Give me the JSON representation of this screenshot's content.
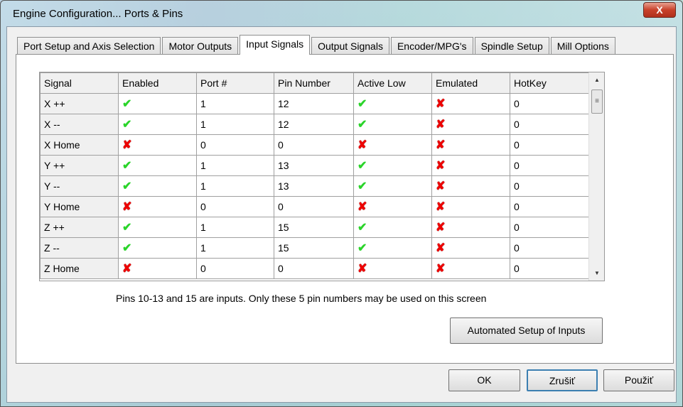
{
  "window": {
    "title": "Engine Configuration... Ports & Pins",
    "close_label": "X"
  },
  "tabs": [
    {
      "label": "Port Setup and Axis Selection"
    },
    {
      "label": "Motor Outputs"
    },
    {
      "label": "Input Signals",
      "active": true
    },
    {
      "label": "Output Signals"
    },
    {
      "label": "Encoder/MPG's"
    },
    {
      "label": "Spindle Setup"
    },
    {
      "label": "Mill Options"
    }
  ],
  "grid": {
    "columns": [
      "Signal",
      "Enabled",
      "Port #",
      "Pin Number",
      "Active Low",
      "Emulated",
      "HotKey"
    ],
    "rows": [
      {
        "signal": "X ++",
        "enabled": true,
        "port": "1",
        "pin": "12",
        "active_low": true,
        "emulated": false,
        "hotkey": "0"
      },
      {
        "signal": "X --",
        "enabled": true,
        "port": "1",
        "pin": "12",
        "active_low": true,
        "emulated": false,
        "hotkey": "0"
      },
      {
        "signal": "X Home",
        "enabled": false,
        "port": "0",
        "pin": "0",
        "active_low": false,
        "emulated": false,
        "hotkey": "0"
      },
      {
        "signal": "Y ++",
        "enabled": true,
        "port": "1",
        "pin": "13",
        "active_low": true,
        "emulated": false,
        "hotkey": "0"
      },
      {
        "signal": "Y --",
        "enabled": true,
        "port": "1",
        "pin": "13",
        "active_low": true,
        "emulated": false,
        "hotkey": "0"
      },
      {
        "signal": "Y Home",
        "enabled": false,
        "port": "0",
        "pin": "0",
        "active_low": false,
        "emulated": false,
        "hotkey": "0"
      },
      {
        "signal": "Z ++",
        "enabled": true,
        "port": "1",
        "pin": "15",
        "active_low": true,
        "emulated": false,
        "hotkey": "0"
      },
      {
        "signal": "Z --",
        "enabled": true,
        "port": "1",
        "pin": "15",
        "active_low": true,
        "emulated": false,
        "hotkey": "0"
      },
      {
        "signal": "Z Home",
        "enabled": false,
        "port": "0",
        "pin": "0",
        "active_low": false,
        "emulated": false,
        "hotkey": "0"
      }
    ],
    "check_icon": "green-check-icon",
    "cross_icon": "red-x-icon"
  },
  "note": "Pins 10-13 and 15 are inputs. Only these 5 pin numbers may be used on this screen",
  "buttons": {
    "automated": "Automated Setup of Inputs",
    "ok": "OK",
    "cancel": "Zrušiť",
    "apply": "Použiť"
  }
}
